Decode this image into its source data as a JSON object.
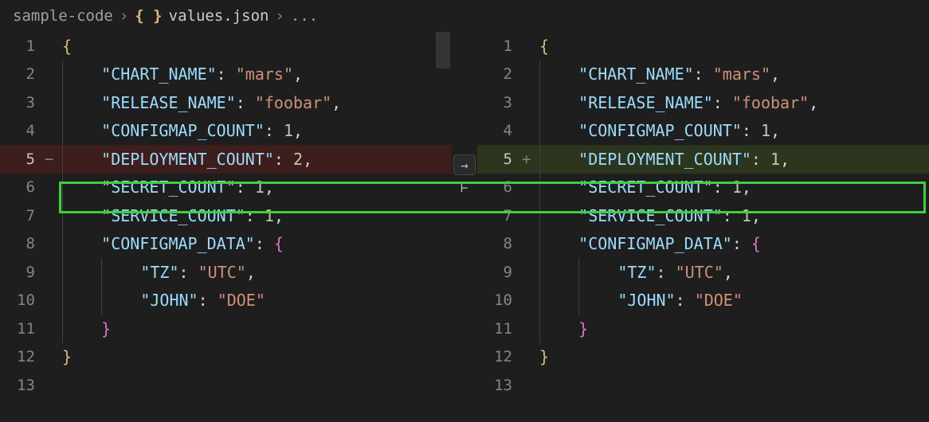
{
  "breadcrumb": {
    "folder": "sample-code",
    "file": "values.json",
    "trail": "..."
  },
  "center": {
    "arrow": "→"
  },
  "left": {
    "lines": [
      {
        "n": "1",
        "marker": "",
        "kind": "plain",
        "segs": [
          {
            "t": "{",
            "c": "tok-brace"
          }
        ],
        "indent": 0,
        "guides": 0
      },
      {
        "n": "2",
        "marker": "",
        "kind": "plain",
        "segs": [
          {
            "t": "\"CHART_NAME\"",
            "c": "tok-key"
          },
          {
            "t": ": ",
            "c": "tok-punc"
          },
          {
            "t": "\"mars\"",
            "c": "tok-str"
          },
          {
            "t": ",",
            "c": "tok-punc"
          }
        ],
        "indent": 2,
        "guides": 1
      },
      {
        "n": "3",
        "marker": "",
        "kind": "plain",
        "segs": [
          {
            "t": "\"RELEASE_NAME\"",
            "c": "tok-key"
          },
          {
            "t": ": ",
            "c": "tok-punc"
          },
          {
            "t": "\"foobar\"",
            "c": "tok-str"
          },
          {
            "t": ",",
            "c": "tok-punc"
          }
        ],
        "indent": 2,
        "guides": 1
      },
      {
        "n": "4",
        "marker": "",
        "kind": "plain",
        "segs": [
          {
            "t": "\"CONFIGMAP_COUNT\"",
            "c": "tok-key"
          },
          {
            "t": ": ",
            "c": "tok-punc"
          },
          {
            "t": "1",
            "c": "tok-num"
          },
          {
            "t": ",",
            "c": "tok-punc"
          }
        ],
        "indent": 2,
        "guides": 1
      },
      {
        "n": "5",
        "marker": "−",
        "kind": "removed",
        "segs": [
          {
            "t": "\"DEPLOYMENT_COUNT\"",
            "c": "tok-key"
          },
          {
            "t": ": ",
            "c": "tok-punc"
          },
          {
            "t": "2",
            "c": "tok-num"
          },
          {
            "t": ",",
            "c": "tok-punc"
          }
        ],
        "indent": 2,
        "guides": 1,
        "current": true
      },
      {
        "n": "6",
        "marker": "",
        "kind": "plain",
        "segs": [
          {
            "t": "\"SECRET_COUNT\"",
            "c": "tok-key"
          },
          {
            "t": ": ",
            "c": "tok-punc"
          },
          {
            "t": "1",
            "c": "tok-num"
          },
          {
            "t": ",",
            "c": "tok-punc"
          }
        ],
        "indent": 2,
        "guides": 1
      },
      {
        "n": "7",
        "marker": "",
        "kind": "plain",
        "segs": [
          {
            "t": "\"SERVICE_COUNT\"",
            "c": "tok-key"
          },
          {
            "t": ": ",
            "c": "tok-punc"
          },
          {
            "t": "1",
            "c": "tok-num"
          },
          {
            "t": ",",
            "c": "tok-punc"
          }
        ],
        "indent": 2,
        "guides": 1
      },
      {
        "n": "8",
        "marker": "",
        "kind": "plain",
        "segs": [
          {
            "t": "\"CONFIGMAP_DATA\"",
            "c": "tok-key"
          },
          {
            "t": ": ",
            "c": "tok-punc"
          },
          {
            "t": "{",
            "c": "tok-brace-p"
          }
        ],
        "indent": 2,
        "guides": 1
      },
      {
        "n": "9",
        "marker": "",
        "kind": "plain",
        "segs": [
          {
            "t": "\"TZ\"",
            "c": "tok-key"
          },
          {
            "t": ": ",
            "c": "tok-punc"
          },
          {
            "t": "\"UTC\"",
            "c": "tok-str"
          },
          {
            "t": ",",
            "c": "tok-punc"
          }
        ],
        "indent": 4,
        "guides": 2
      },
      {
        "n": "10",
        "marker": "",
        "kind": "plain",
        "segs": [
          {
            "t": "\"JOHN\"",
            "c": "tok-key"
          },
          {
            "t": ": ",
            "c": "tok-punc"
          },
          {
            "t": "\"DOE\"",
            "c": "tok-str"
          }
        ],
        "indent": 4,
        "guides": 2
      },
      {
        "n": "11",
        "marker": "",
        "kind": "plain",
        "segs": [
          {
            "t": "}",
            "c": "tok-brace-p"
          }
        ],
        "indent": 2,
        "guides": 1
      },
      {
        "n": "12",
        "marker": "",
        "kind": "plain",
        "segs": [
          {
            "t": "}",
            "c": "tok-brace"
          }
        ],
        "indent": 0,
        "guides": 0
      },
      {
        "n": "13",
        "marker": "",
        "kind": "plain",
        "segs": [],
        "indent": 0,
        "guides": 0
      }
    ]
  },
  "right": {
    "lines": [
      {
        "n": "1",
        "marker": "",
        "kind": "plain",
        "segs": [
          {
            "t": "{",
            "c": "tok-brace"
          }
        ],
        "indent": 0,
        "guides": 0
      },
      {
        "n": "2",
        "marker": "",
        "kind": "plain",
        "segs": [
          {
            "t": "\"CHART_NAME\"",
            "c": "tok-key"
          },
          {
            "t": ": ",
            "c": "tok-punc"
          },
          {
            "t": "\"mars\"",
            "c": "tok-str"
          },
          {
            "t": ",",
            "c": "tok-punc"
          }
        ],
        "indent": 2,
        "guides": 1
      },
      {
        "n": "3",
        "marker": "",
        "kind": "plain",
        "segs": [
          {
            "t": "\"RELEASE_NAME\"",
            "c": "tok-key"
          },
          {
            "t": ": ",
            "c": "tok-punc"
          },
          {
            "t": "\"foobar\"",
            "c": "tok-str"
          },
          {
            "t": ",",
            "c": "tok-punc"
          }
        ],
        "indent": 2,
        "guides": 1
      },
      {
        "n": "4",
        "marker": "",
        "kind": "plain",
        "segs": [
          {
            "t": "\"CONFIGMAP_COUNT\"",
            "c": "tok-key"
          },
          {
            "t": ": ",
            "c": "tok-punc"
          },
          {
            "t": "1",
            "c": "tok-num"
          },
          {
            "t": ",",
            "c": "tok-punc"
          }
        ],
        "indent": 2,
        "guides": 1
      },
      {
        "n": "5",
        "marker": "+",
        "kind": "added",
        "segs": [
          {
            "t": "\"DEPLOYMENT_COUNT\"",
            "c": "tok-key"
          },
          {
            "t": ": ",
            "c": "tok-punc"
          },
          {
            "t": "1",
            "c": "tok-num"
          },
          {
            "t": ",",
            "c": "tok-punc"
          }
        ],
        "indent": 2,
        "guides": 1,
        "current": true
      },
      {
        "n": "6",
        "marker": "",
        "kind": "plain",
        "segs": [
          {
            "t": "\"SECRET_COUNT\"",
            "c": "tok-key"
          },
          {
            "t": ": ",
            "c": "tok-punc"
          },
          {
            "t": "1",
            "c": "tok-num"
          },
          {
            "t": ",",
            "c": "tok-punc"
          }
        ],
        "indent": 2,
        "guides": 1
      },
      {
        "n": "7",
        "marker": "",
        "kind": "plain",
        "segs": [
          {
            "t": "\"SERVICE_COUNT\"",
            "c": "tok-key"
          },
          {
            "t": ": ",
            "c": "tok-punc"
          },
          {
            "t": "1",
            "c": "tok-num"
          },
          {
            "t": ",",
            "c": "tok-punc"
          }
        ],
        "indent": 2,
        "guides": 1
      },
      {
        "n": "8",
        "marker": "",
        "kind": "plain",
        "segs": [
          {
            "t": "\"CONFIGMAP_DATA\"",
            "c": "tok-key"
          },
          {
            "t": ": ",
            "c": "tok-punc"
          },
          {
            "t": "{",
            "c": "tok-brace-p"
          }
        ],
        "indent": 2,
        "guides": 1
      },
      {
        "n": "9",
        "marker": "",
        "kind": "plain",
        "segs": [
          {
            "t": "\"TZ\"",
            "c": "tok-key"
          },
          {
            "t": ": ",
            "c": "tok-punc"
          },
          {
            "t": "\"UTC\"",
            "c": "tok-str"
          },
          {
            "t": ",",
            "c": "tok-punc"
          }
        ],
        "indent": 4,
        "guides": 2
      },
      {
        "n": "10",
        "marker": "",
        "kind": "plain",
        "segs": [
          {
            "t": "\"JOHN\"",
            "c": "tok-key"
          },
          {
            "t": ": ",
            "c": "tok-punc"
          },
          {
            "t": "\"DOE\"",
            "c": "tok-str"
          }
        ],
        "indent": 4,
        "guides": 2
      },
      {
        "n": "11",
        "marker": "",
        "kind": "plain",
        "segs": [
          {
            "t": "}",
            "c": "tok-brace-p"
          }
        ],
        "indent": 2,
        "guides": 1
      },
      {
        "n": "12",
        "marker": "",
        "kind": "plain",
        "segs": [
          {
            "t": "}",
            "c": "tok-brace"
          }
        ],
        "indent": 0,
        "guides": 0
      },
      {
        "n": "13",
        "marker": "",
        "kind": "plain",
        "segs": [],
        "indent": 0,
        "guides": 0
      }
    ]
  }
}
